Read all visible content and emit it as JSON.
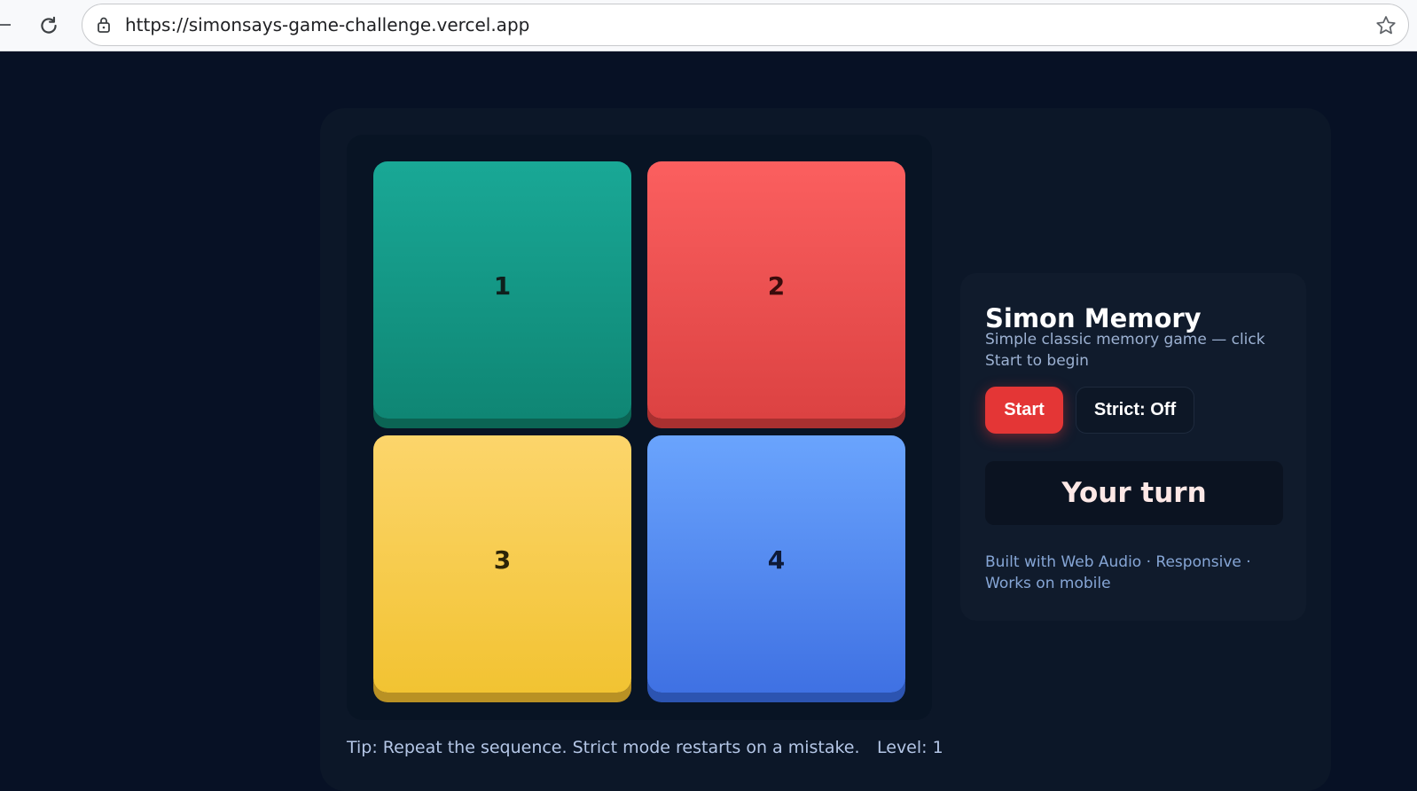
{
  "browser": {
    "url": "https://simonsays-game-challenge.vercel.app"
  },
  "board": {
    "pads": [
      {
        "label": "1",
        "color": "#16a08f"
      },
      {
        "label": "2",
        "color": "#f25252"
      },
      {
        "label": "3",
        "color": "#f8cd4f"
      },
      {
        "label": "4",
        "color": "#568cf2"
      }
    ]
  },
  "footer": {
    "tip": "Tip: Repeat the sequence. Strict mode restarts on a mistake.",
    "level": "Level: 1"
  },
  "panel": {
    "title": "Simon Memory",
    "subtitle": "Simple classic memory game — click Start to begin",
    "start_label": "Start",
    "strict_label": "Strict: Off",
    "status": "Your turn",
    "credits": "Built with Web Audio · Responsive · Works on mobile"
  },
  "colors": {
    "background": "#071125",
    "card": "#0c1728",
    "accent": "#e43636"
  }
}
